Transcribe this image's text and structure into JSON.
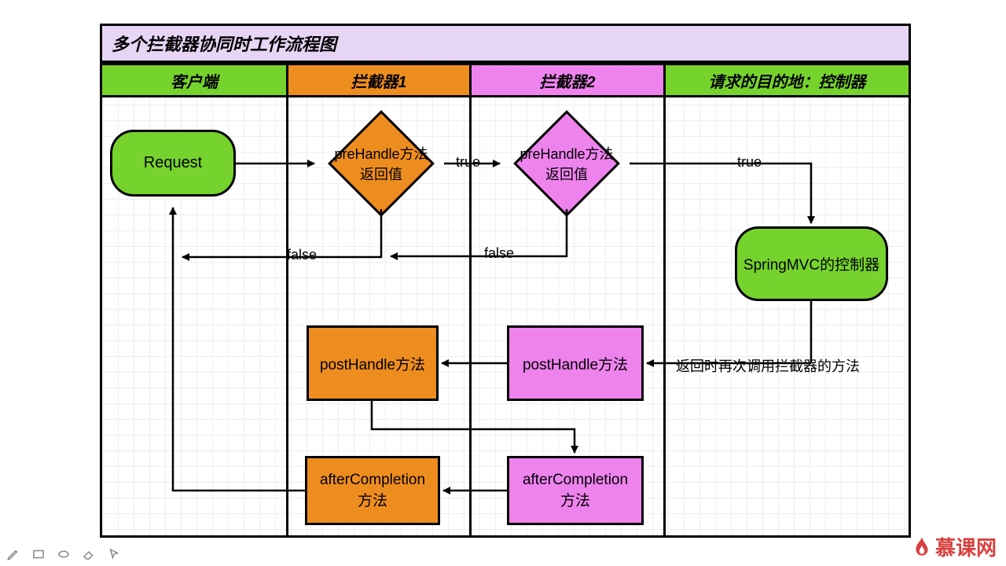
{
  "title": "多个拦截器协同时工作流程图",
  "lanes": [
    {
      "header": "客户端",
      "headerColor": "#76D22C"
    },
    {
      "header": "拦截器1",
      "headerColor": "#EE8D1F"
    },
    {
      "header": "拦截器2",
      "headerColor": "#EE83EE"
    },
    {
      "header": "请求的目的地：控制器",
      "headerColor": "#76D22C"
    }
  ],
  "nodes": {
    "request": {
      "label": "Request",
      "fill": "#76D22C"
    },
    "prehandle1": {
      "line1": "preHandle方法",
      "line2": "返回值",
      "fill": "#EE8D1F"
    },
    "prehandle2": {
      "line1": "preHandle方法",
      "line2": "返回值",
      "fill": "#EE83EE"
    },
    "controller": {
      "label": "SpringMVC的控制器",
      "fill": "#76D22C"
    },
    "posthandle1": {
      "label": "postHandle方法",
      "fill": "#EE8D1F"
    },
    "posthandle2": {
      "label": "postHandle方法",
      "fill": "#EE83EE"
    },
    "after1": {
      "line1": "afterCompletion",
      "line2": "方法",
      "fill": "#EE8D1F"
    },
    "after2": {
      "line1": "afterCompletion",
      "line2": "方法",
      "fill": "#EE83EE"
    }
  },
  "edgeLabels": {
    "true1": "true",
    "true2": "true",
    "false1": "false",
    "false2": "false",
    "returnNote": "返回时再次调用拦截器的方法"
  },
  "brand": "慕课网",
  "chart_data": {
    "type": "swimlane-flowchart",
    "title": "多个拦截器协同时工作流程图",
    "lanes": [
      "客户端",
      "拦截器1",
      "拦截器2",
      "请求的目的地：控制器"
    ],
    "nodes": [
      {
        "id": "request",
        "lane": "客户端",
        "shape": "rounded",
        "label": "Request"
      },
      {
        "id": "pre1",
        "lane": "拦截器1",
        "shape": "decision",
        "label": "preHandle方法返回值"
      },
      {
        "id": "pre2",
        "lane": "拦截器2",
        "shape": "decision",
        "label": "preHandle方法返回值"
      },
      {
        "id": "ctrl",
        "lane": "请求的目的地：控制器",
        "shape": "rounded",
        "label": "SpringMVC的控制器"
      },
      {
        "id": "post2",
        "lane": "拦截器2",
        "shape": "process",
        "label": "postHandle方法"
      },
      {
        "id": "post1",
        "lane": "拦截器1",
        "shape": "process",
        "label": "postHandle方法"
      },
      {
        "id": "after2",
        "lane": "拦截器2",
        "shape": "process",
        "label": "afterCompletion方法"
      },
      {
        "id": "after1",
        "lane": "拦截器1",
        "shape": "process",
        "label": "afterCompletion方法"
      }
    ],
    "edges": [
      {
        "from": "request",
        "to": "pre1",
        "label": ""
      },
      {
        "from": "pre1",
        "to": "pre2",
        "label": "true"
      },
      {
        "from": "pre1",
        "to": "request",
        "label": "false"
      },
      {
        "from": "pre2",
        "to": "ctrl",
        "label": "true",
        "via": "请求的目的地：控制器"
      },
      {
        "from": "pre2",
        "to": "pre1",
        "label": "false"
      },
      {
        "from": "ctrl",
        "to": "post2",
        "label": "返回时再次调用拦截器的方法"
      },
      {
        "from": "post2",
        "to": "post1",
        "label": ""
      },
      {
        "from": "post1",
        "to": "after2",
        "label": ""
      },
      {
        "from": "after2",
        "to": "after1",
        "label": ""
      },
      {
        "from": "after1",
        "to": "request",
        "label": ""
      }
    ]
  }
}
